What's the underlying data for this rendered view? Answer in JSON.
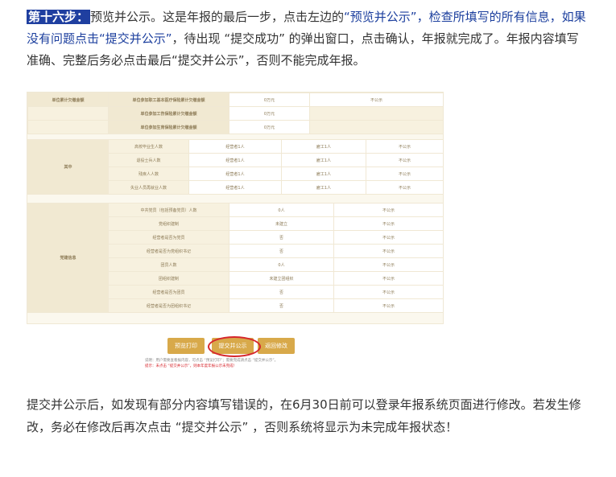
{
  "paragraph1": {
    "step_label": "第十六步：",
    "text_a": "预览并公示。这是年报的最后一步，点击左边的",
    "link_a": "“预览并公示”，检查所填写的所有信息，如果没有问题点击“提交并公示”",
    "text_b": "，待出现 “提交成功” 的弹出窗口，点击确认，年报就完成了。年报内容填写准确、完整后务必点击最后“提交并公示”，否则不能完成年报。"
  },
  "screenshot": {
    "top_rows": [
      {
        "group": "单位累计欠缴金额",
        "label": "单位参加职工基本医疗保险累计欠缴金额",
        "value": "0万元",
        "note": "不公示"
      },
      {
        "group": "",
        "label": "单位参加工伤保险累计欠缴金额",
        "value": "0万元",
        "note": ""
      },
      {
        "group": "",
        "label": "单位参加生育保险累计欠缴金额",
        "value": "0万元",
        "note": ""
      }
    ],
    "mid_group": "其中",
    "mid_rows": [
      {
        "label": "高校毕业生人数",
        "v1": "经营者1人",
        "v2": "雇工1人",
        "v3": "不公示"
      },
      {
        "label": "退役士兵人数",
        "v1": "经营者1人",
        "v2": "雇工1人",
        "v3": "不公示"
      },
      {
        "label": "残疾人人数",
        "v1": "经营者1人",
        "v2": "雇工1人",
        "v3": "不公示"
      },
      {
        "label": "失业人员再就业人数",
        "v1": "经营者1人",
        "v2": "雇工1人",
        "v3": "不公示"
      }
    ],
    "party_group": "党建信息",
    "party_rows": [
      {
        "label": "中共党员（包括预备党员）人数",
        "value": "0人",
        "note": "不公示"
      },
      {
        "label": "党组织建制",
        "value": "未建立",
        "note": "不公示"
      },
      {
        "label": "经营者是否为党员",
        "value": "否",
        "note": "不公示"
      },
      {
        "label": "经营者是否为党组织书记",
        "value": "否",
        "note": "不公示"
      },
      {
        "label": "团员人数",
        "value": "0人",
        "note": "不公示"
      },
      {
        "label": "团组织建制",
        "value": "未建立团组织",
        "note": "不公示"
      },
      {
        "label": "经营者是否为团员",
        "value": "否",
        "note": "不公示"
      },
      {
        "label": "经营者是否为团组织书记",
        "value": "否",
        "note": "不公示"
      }
    ],
    "buttons": {
      "preview": "预览打印",
      "submit": "提交并公示",
      "back": "返回修改"
    },
    "note_line1": "说明：用户需要查看报内容，可点击 “预览打印”；需要完成请点击 “提交并公示”。",
    "note_line2": "提示：未点击 “提交并公示”，则本年度年报公示未完成！"
  },
  "paragraph2": {
    "text": "提交并公示后，如发现有部分内容填写错误的，在6月30日前可以登录年报系统页面进行修改。若发生修改，务必在修改后再次点击 “提交并公示” ，否则系统将显示为未完成年报状态！"
  },
  "colors": {
    "step_label_bg": "#1f3fa0",
    "link_text": "#1c3f9e",
    "button_gold": "#d8a94a",
    "highlight_circle": "#d6262c"
  }
}
